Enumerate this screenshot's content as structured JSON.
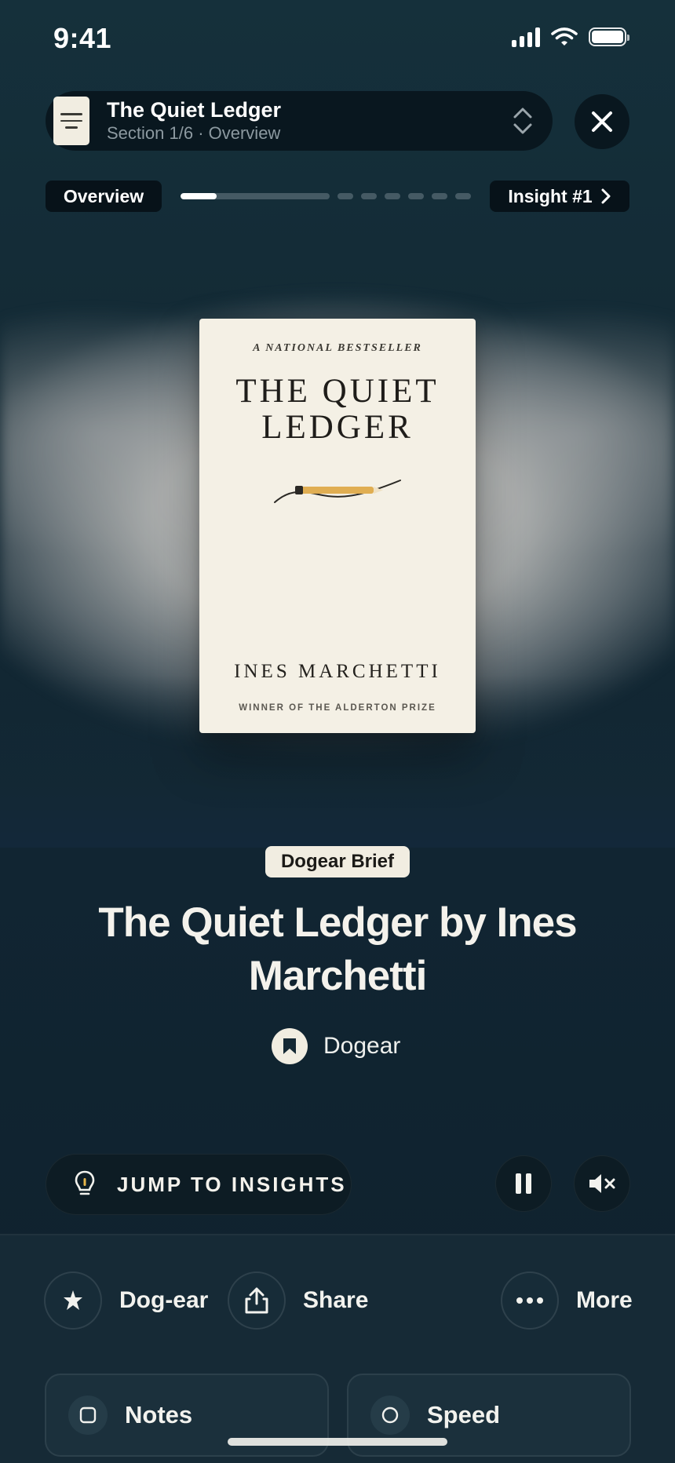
{
  "status_bar": {
    "time": "9:41"
  },
  "header": {
    "book_title": "The Quiet Ledger",
    "section_text": "Section 1/6 · Overview"
  },
  "progress": {
    "left_label": "Overview",
    "right_label": "Insight #1",
    "current_segment_fraction": 0.24,
    "segment_count": 7
  },
  "cover": {
    "kicker": "A NATIONAL BESTSELLER",
    "title_line1": "THE QUIET",
    "title_line2": "LEDGER",
    "author": "INES MARCHETTI",
    "prize": "WINNER OF THE ALDERTON PRIZE",
    "accent_color": "#e0ae52"
  },
  "content": {
    "badge": "Dogear Brief",
    "title": "The Quiet Ledger by Ines Marchetti",
    "brand": "Dogear"
  },
  "controls": {
    "jump_label": "JUMP TO INSIGHTS"
  },
  "actions": {
    "dogear": "Dog-ear",
    "share": "Share",
    "more": "More"
  },
  "cards": {
    "notes": "Notes",
    "speed": "Speed"
  },
  "colors": {
    "background": "#13252f",
    "cream": "#f1ede1",
    "bulb_accent": "#e7b64a"
  }
}
